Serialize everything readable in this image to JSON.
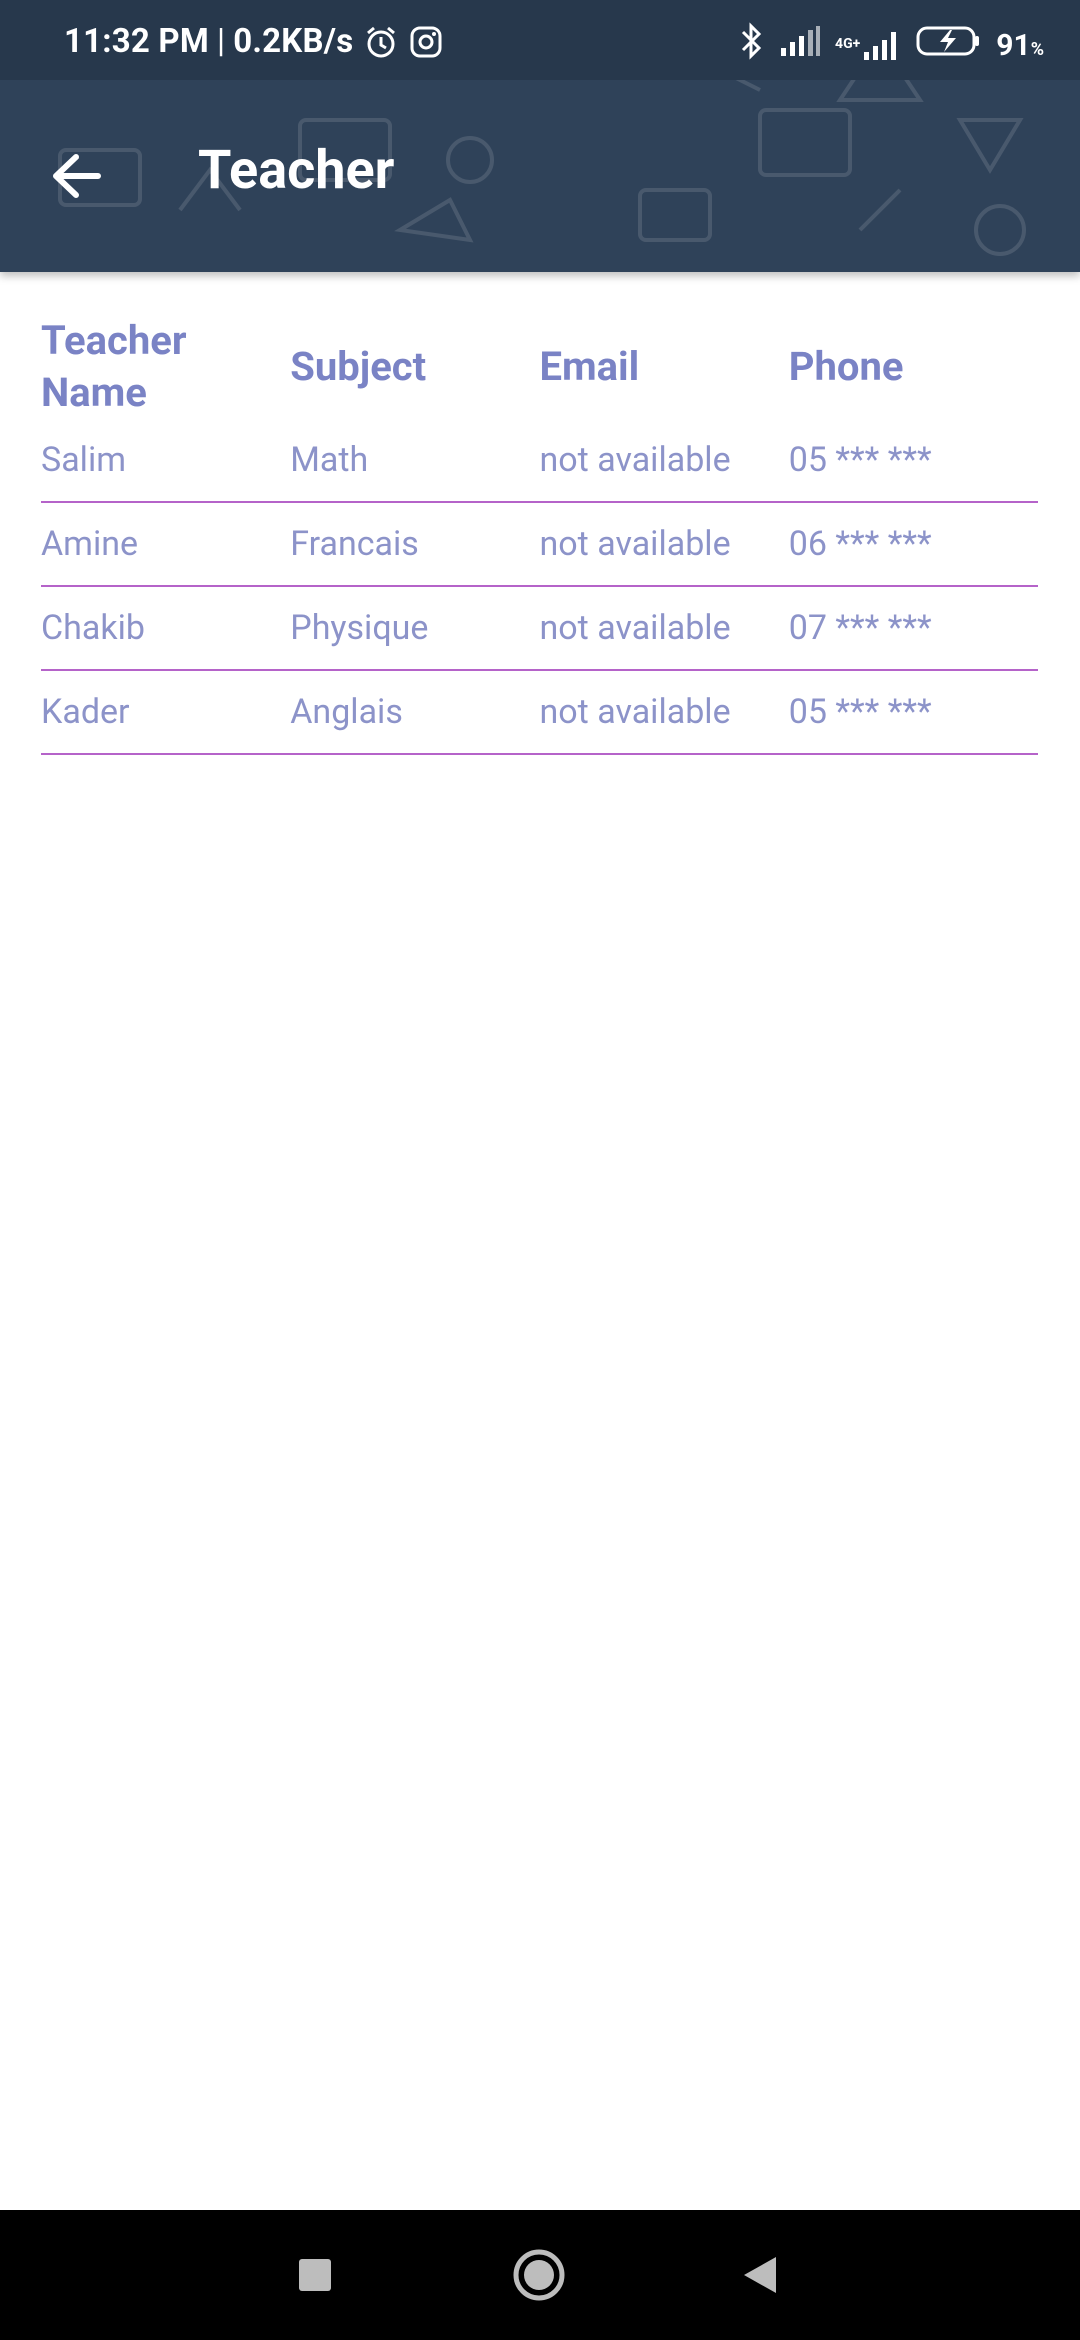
{
  "status_bar": {
    "time": "11:32 PM",
    "separator": "|",
    "net_speed": "0.2KB/s",
    "network_label": "4G+",
    "battery": "91",
    "battery_unit": "%"
  },
  "toolbar": {
    "title": "Teacher",
    "back_icon": "arrow-left-icon"
  },
  "table": {
    "headers": [
      "Teacher Name",
      "Subject",
      "Email",
      "Phone"
    ],
    "rows": [
      [
        "Salim",
        "Math",
        "not available",
        "05 *** ***"
      ],
      [
        "Amine",
        "Francais",
        "not available",
        "06 *** ***"
      ],
      [
        "Chakib",
        "Physique",
        "not available",
        "07 *** ***"
      ],
      [
        "Kader",
        "Anglais",
        "not available",
        "05 *** ***"
      ]
    ]
  },
  "colors": {
    "header_bg": "#2f4259",
    "header_text": "#7a83c5",
    "cell_text": "#8c93c9",
    "divider": "#b563c9"
  },
  "nav": {
    "recents_icon": "square-icon",
    "home_icon": "circle-home-icon",
    "back_icon": "triangle-back-icon"
  }
}
